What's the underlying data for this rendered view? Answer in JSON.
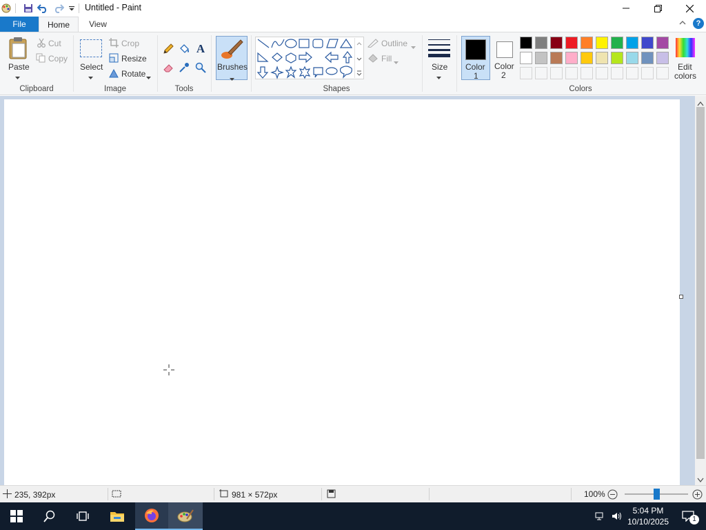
{
  "window": {
    "title": "Untitled - Paint"
  },
  "tabs": {
    "file": "File",
    "home": "Home",
    "view": "View"
  },
  "clipboard": {
    "paste": "Paste",
    "cut": "Cut",
    "copy": "Copy",
    "group": "Clipboard"
  },
  "image": {
    "select": "Select",
    "crop": "Crop",
    "resize": "Resize",
    "rotate": "Rotate",
    "group": "Image"
  },
  "tools": {
    "group": "Tools",
    "items": [
      "pencil-icon",
      "fill-icon",
      "text-icon",
      "eraser-icon",
      "color-picker-icon",
      "magnifier-icon"
    ]
  },
  "brushes": {
    "label": "Brushes"
  },
  "shapes": {
    "group": "Shapes",
    "outline": "Outline",
    "fill": "Fill"
  },
  "size": {
    "label": "Size"
  },
  "colors": {
    "color1_label": "Color",
    "color1_num": "1",
    "color2_label": "Color",
    "color2_num": "2",
    "color1": "#000000",
    "color2": "#ffffff",
    "edit_label": "Edit",
    "edit_label2": "colors",
    "group": "Colors",
    "palette_row1": [
      "#000000",
      "#7f7f7f",
      "#880015",
      "#ed1c24",
      "#ff7f27",
      "#fff200",
      "#22b14c",
      "#00a2e8",
      "#3f48cc",
      "#a349a4"
    ],
    "palette_row2": [
      "#ffffff",
      "#c3c3c3",
      "#b97a57",
      "#ffaec9",
      "#ffc90e",
      "#efe4b0",
      "#b5e61d",
      "#99d9ea",
      "#7092be",
      "#c8bfe7"
    ]
  },
  "status": {
    "cursor_pos": "235, 392px",
    "canvas_size": "981 × 572px",
    "zoom": "100%",
    "zoom_fraction": 0.5
  },
  "taskbar": {
    "time": "5:04 PM",
    "date": "10/10/2025",
    "notifications": "1"
  }
}
